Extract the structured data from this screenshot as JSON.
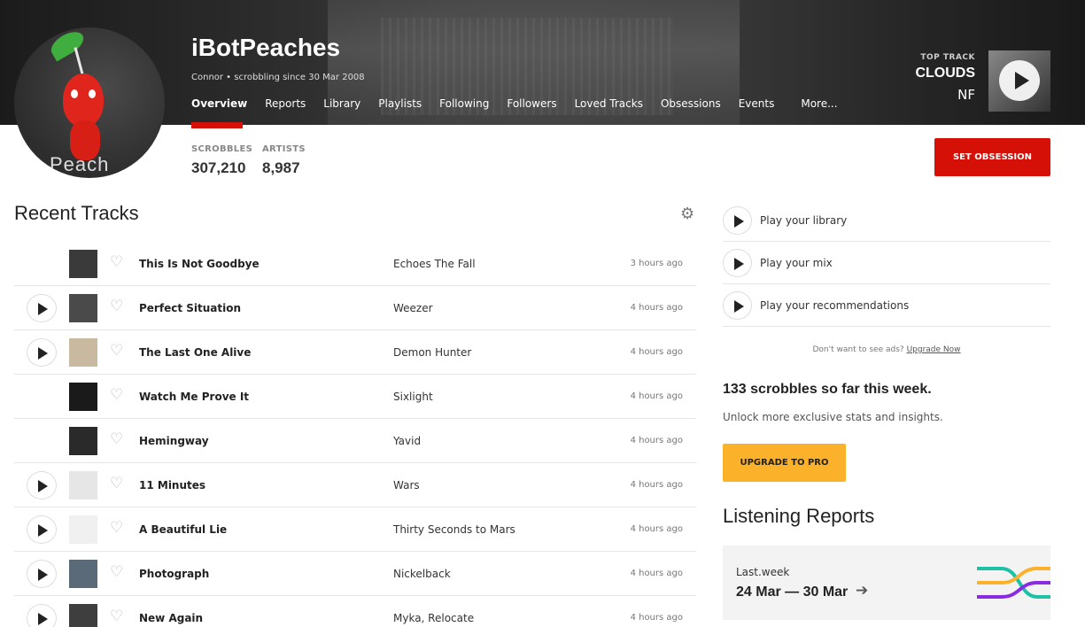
{
  "profile": {
    "username": "iBotPeaches",
    "subline": "Connor • scrobbling since 30 Mar 2008",
    "avatar_text": "Peach"
  },
  "nav": {
    "items": [
      {
        "label": "Overview",
        "active": true
      },
      {
        "label": "Reports"
      },
      {
        "label": "Library"
      },
      {
        "label": "Playlists"
      },
      {
        "label": "Following"
      },
      {
        "label": "Followers"
      },
      {
        "label": "Loved Tracks"
      },
      {
        "label": "Obsessions"
      },
      {
        "label": "Events"
      },
      {
        "label": "More..."
      }
    ]
  },
  "top_track": {
    "label": "TOP TRACK",
    "title": "CLOUDS",
    "artist": "NF"
  },
  "stats": {
    "scrobbles_label": "SCROBBLES",
    "scrobbles_value": "307,210",
    "artists_label": "ARTISTS",
    "artists_value": "8,987"
  },
  "set_obsession_label": "SET OBSESSION",
  "recent": {
    "title": "Recent Tracks",
    "tracks": [
      {
        "title": "This Is Not Goodbye",
        "artist": "Echoes The Fall",
        "time": "3 hours ago",
        "playable": false,
        "art_color": "#3a3a3a"
      },
      {
        "title": "Perfect Situation",
        "artist": "Weezer",
        "time": "4 hours ago",
        "playable": true,
        "art_color": "#4a4a4a"
      },
      {
        "title": "The Last One Alive",
        "artist": "Demon Hunter",
        "time": "4 hours ago",
        "playable": true,
        "art_color": "#c9b9a0"
      },
      {
        "title": "Watch Me Prove It",
        "artist": "Sixlight",
        "time": "4 hours ago",
        "playable": false,
        "art_color": "#1a1a1a"
      },
      {
        "title": "Hemingway",
        "artist": "Yavid",
        "time": "4 hours ago",
        "playable": false,
        "art_color": "#2a2a2a"
      },
      {
        "title": "11 Minutes",
        "artist": "Wars",
        "time": "4 hours ago",
        "playable": true,
        "art_color": "#e6e6e6"
      },
      {
        "title": "A Beautiful Lie",
        "artist": "Thirty Seconds to Mars",
        "time": "4 hours ago",
        "playable": true,
        "art_color": "#f0f0f0"
      },
      {
        "title": "Photograph",
        "artist": "Nickelback",
        "time": "4 hours ago",
        "playable": true,
        "art_color": "#5a6a78"
      },
      {
        "title": "New Again",
        "artist": "Myka, Relocate",
        "time": "4 hours ago",
        "playable": true,
        "art_color": "#3e3e3e"
      }
    ]
  },
  "sidebar": {
    "play_items": [
      {
        "label": "Play your library"
      },
      {
        "label": "Play your mix"
      },
      {
        "label": "Play your recommendations"
      }
    ],
    "ads_text": "Don't want to see ads?",
    "ads_link": "Upgrade Now",
    "week_scrobbles": "133 scrobbles so far this week.",
    "unlock_text": "Unlock more exclusive stats and insights.",
    "upgrade_label": "UPGRADE TO PRO",
    "listening_reports_title": "Listening Reports",
    "report_brand": "Last.week",
    "report_range": "24 Mar — 30 Mar"
  },
  "colors": {
    "accent_red": "#d51007",
    "pro_yellow": "#fbb12a"
  }
}
